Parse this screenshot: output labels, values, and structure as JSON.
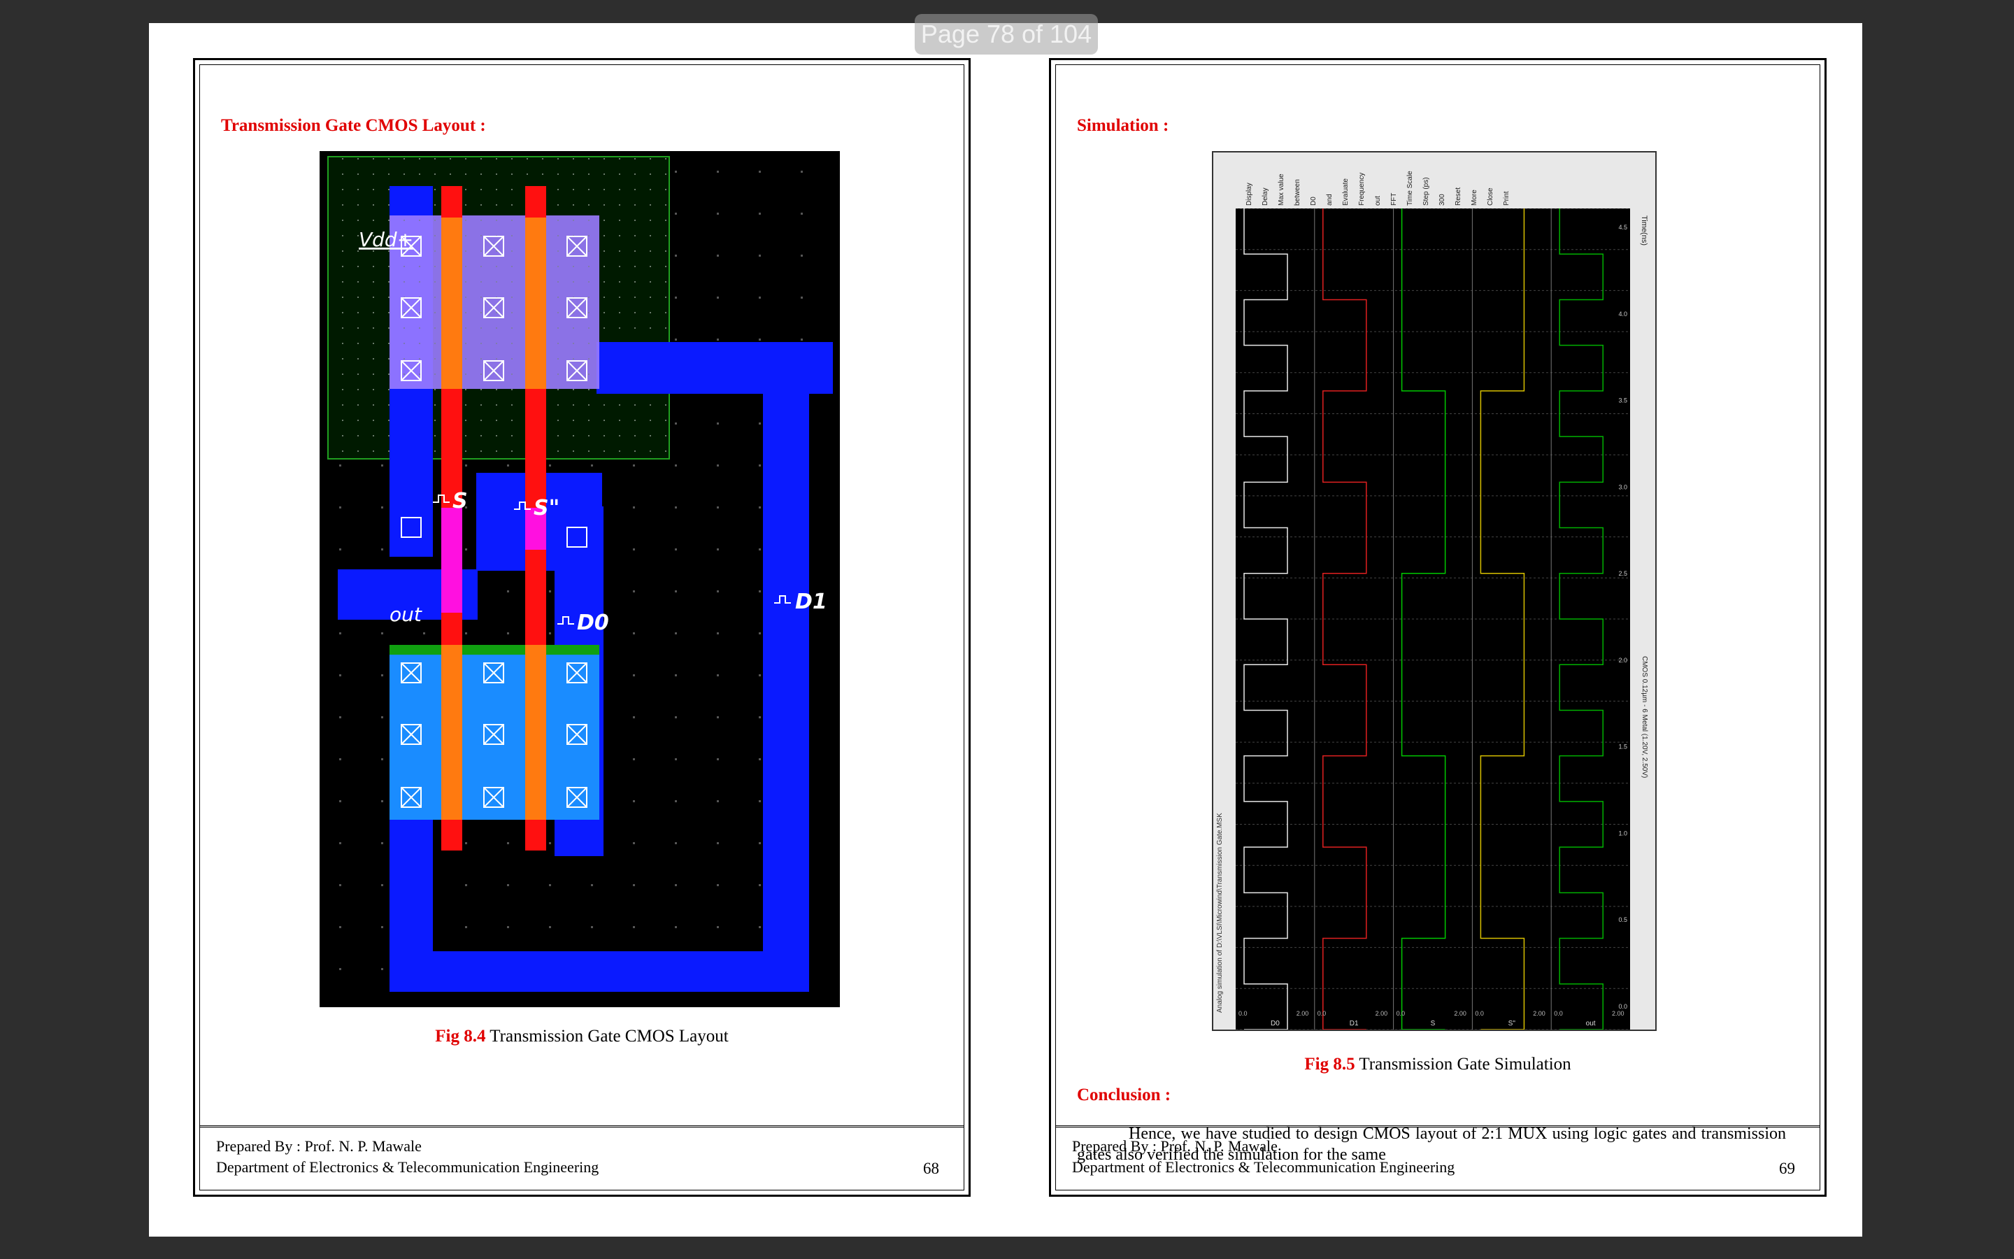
{
  "viewer": {
    "page_indicator": "Page 78 of 104"
  },
  "left_page": {
    "heading": "Transmission Gate CMOS Layout :",
    "layout_labels": {
      "vdd": "Vdd+",
      "s": "S",
      "s_bar": "S\"",
      "out": "out",
      "d0": "D0",
      "d1": "D1"
    },
    "figure": {
      "number": "Fig 8.4",
      "caption": " Transmission Gate CMOS Layout"
    },
    "footer": {
      "prepared_by": "Prepared By : Prof. N. P. Mawale",
      "department": "Department of Electronics & Telecommunication Engineering",
      "page_number": "68"
    }
  },
  "right_page": {
    "heading": "Simulation :",
    "figure": {
      "number": "Fig 8.5",
      "caption": " Transmission Gate Simulation"
    },
    "conclusion_heading": "Conclusion :",
    "conclusion_text": "Hence, we have studied to design CMOS layout of 2:1 MUX using logic gates and transmission gates also verified the simulation for the same",
    "sim_signals": [
      "D0",
      "D1",
      "S",
      "S\"",
      "out"
    ],
    "sim_panel_labels": [
      "Display",
      "Delay",
      "Max value",
      "between",
      "D0",
      "and",
      "Evaluate",
      "Frequency",
      "out",
      "FFT",
      "Time Scale",
      "Step (ps)",
      "300",
      "Reset",
      "More",
      "Close",
      "Print"
    ],
    "sim_time_ticks": [
      "0.0",
      "0.5",
      "1.0",
      "1.5",
      "2.0",
      "2.5",
      "3.0",
      "3.5",
      "4.0",
      "4.5"
    ],
    "sim_time_label": "Time(ns)",
    "sim_voltage_labels": [
      "0.0",
      "2.00"
    ],
    "sim_bottom_status": "CMOS 0.12µm - 6 Metal (1.20V, 2.50V)",
    "sim_file_path": "Analog simulation of D:\\VLSI\\Microwind\\Transmission Gate.MSK",
    "colors": {
      "D0": "#e8e8e8",
      "D1": "#e02020",
      "S": "#00c800",
      "S_bar": "#d8c000",
      "out": "#00b000"
    }
  },
  "colors": {
    "accent_red": "#e00000"
  }
}
